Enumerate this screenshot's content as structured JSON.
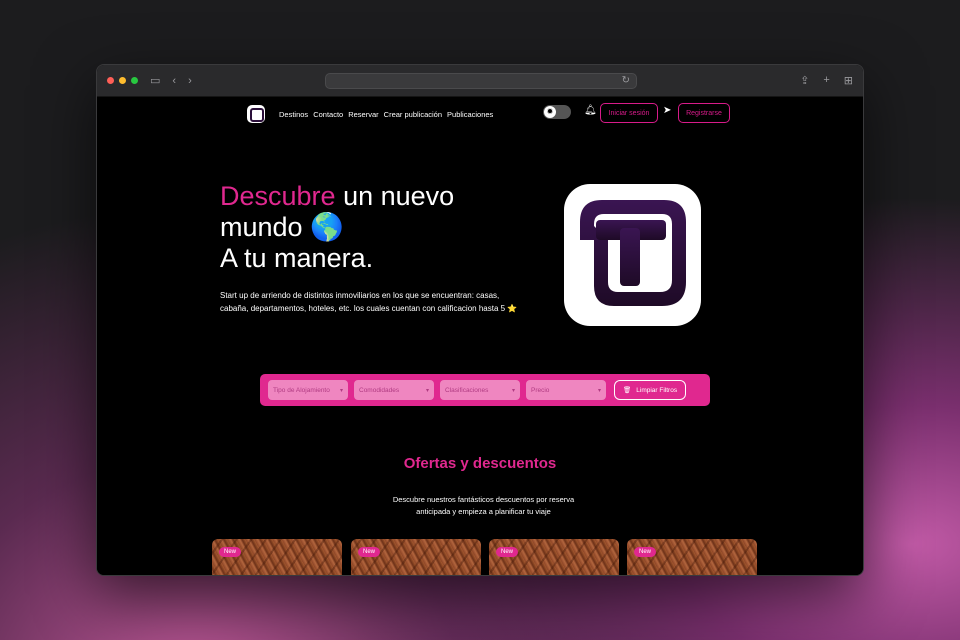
{
  "nav": {
    "links": [
      "Destinos",
      "Contacto",
      "Reservar",
      "Crear publicación",
      "Publicaciones"
    ],
    "login_label": "Iniciar sesión",
    "register_label": "Registrarse"
  },
  "hero": {
    "title_accent": "Descubre",
    "title_rest_1": " un nuevo",
    "title_line2": "mundo 🌎",
    "title_line3": "A tu manera.",
    "description": "Start up de arriendo de distintos inmoviliarios en los que se encuentran: casas, cabaña, departamentos, hoteles, etc. los cuales cuentan con calificacion hasta 5",
    "description_star": "⭐"
  },
  "filters": {
    "selects": [
      "Tipo de Alojamiento",
      "Comodidades",
      "Clasificaciones",
      "Precio"
    ],
    "clear_label": "Limpiar Filtros"
  },
  "offers": {
    "title": "Ofertas y descuentos",
    "description": "Descubre nuestros fantásticos descuentos por reserva anticipada y empieza a planificar tu viaje",
    "cards": [
      {
        "badge": "New"
      },
      {
        "badge": "New"
      },
      {
        "badge": "New"
      },
      {
        "badge": "New"
      }
    ]
  },
  "colors": {
    "accent": "#e0288f",
    "background": "#000000",
    "logo_purple": "#2b0f3a"
  },
  "icons": {
    "theme_toggle": "sun-icon",
    "notifications": "bell-icon",
    "messages": "send-icon",
    "clear_filters": "trash-icon"
  }
}
